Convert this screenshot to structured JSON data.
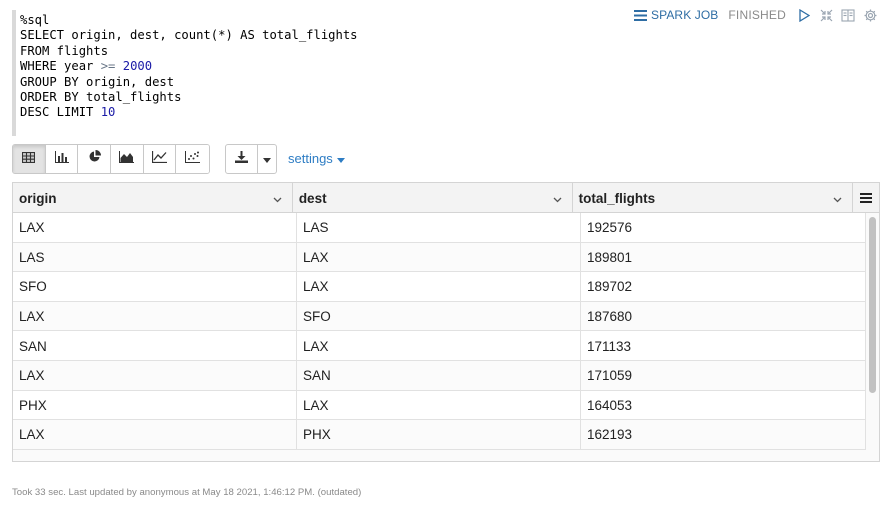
{
  "editor": {
    "lines": [
      [
        {
          "t": "%sql",
          "c": ""
        }
      ],
      [
        {
          "t": "SELECT origin, dest, count(*) AS total_flights",
          "c": ""
        }
      ],
      [
        {
          "t": "FROM flights",
          "c": ""
        }
      ],
      [
        {
          "t": "WHERE year ",
          "c": ""
        },
        {
          "t": ">=",
          "c": "op"
        },
        {
          "t": " ",
          "c": ""
        },
        {
          "t": "2000",
          "c": "num"
        }
      ],
      [
        {
          "t": "GROUP BY origin, dest",
          "c": ""
        }
      ],
      [
        {
          "t": "ORDER BY total_flights",
          "c": ""
        }
      ],
      [
        {
          "t": "DESC LIMIT ",
          "c": ""
        },
        {
          "t": "10",
          "c": "num"
        }
      ]
    ]
  },
  "status": {
    "job_label": "SPARK JOB",
    "state": "FINISHED",
    "icons": [
      "list-icon",
      "play-icon",
      "collapse-icon",
      "book-icon",
      "gear-icon"
    ]
  },
  "toolbar": {
    "viz_buttons": [
      {
        "name": "table-view-button",
        "icon": "table-icon"
      },
      {
        "name": "bar-chart-button",
        "icon": "bar-chart-icon"
      },
      {
        "name": "pie-chart-button",
        "icon": "pie-chart-icon"
      },
      {
        "name": "area-chart-button",
        "icon": "area-chart-icon"
      },
      {
        "name": "line-chart-button",
        "icon": "line-chart-icon"
      },
      {
        "name": "scatter-chart-button",
        "icon": "scatter-chart-icon"
      }
    ],
    "active": "table-view-button",
    "settings_label": "settings"
  },
  "grid": {
    "columns": [
      "origin",
      "dest",
      "total_flights"
    ],
    "rows": [
      [
        "LAX",
        "LAS",
        "192576"
      ],
      [
        "LAS",
        "LAX",
        "189801"
      ],
      [
        "SFO",
        "LAX",
        "189702"
      ],
      [
        "LAX",
        "SFO",
        "187680"
      ],
      [
        "SAN",
        "LAX",
        "171133"
      ],
      [
        "LAX",
        "SAN",
        "171059"
      ],
      [
        "PHX",
        "LAX",
        "164053"
      ],
      [
        "LAX",
        "PHX",
        "162193"
      ]
    ]
  },
  "footer": {
    "text": "Took 33 sec. Last updated by anonymous at May 18 2021, 1:46:12 PM. (outdated)"
  },
  "colors": {
    "link": "#2e6da4",
    "settings": "#2e7dc4",
    "sql_number": "#1a1aa6",
    "muted": "#8a8a8a"
  }
}
